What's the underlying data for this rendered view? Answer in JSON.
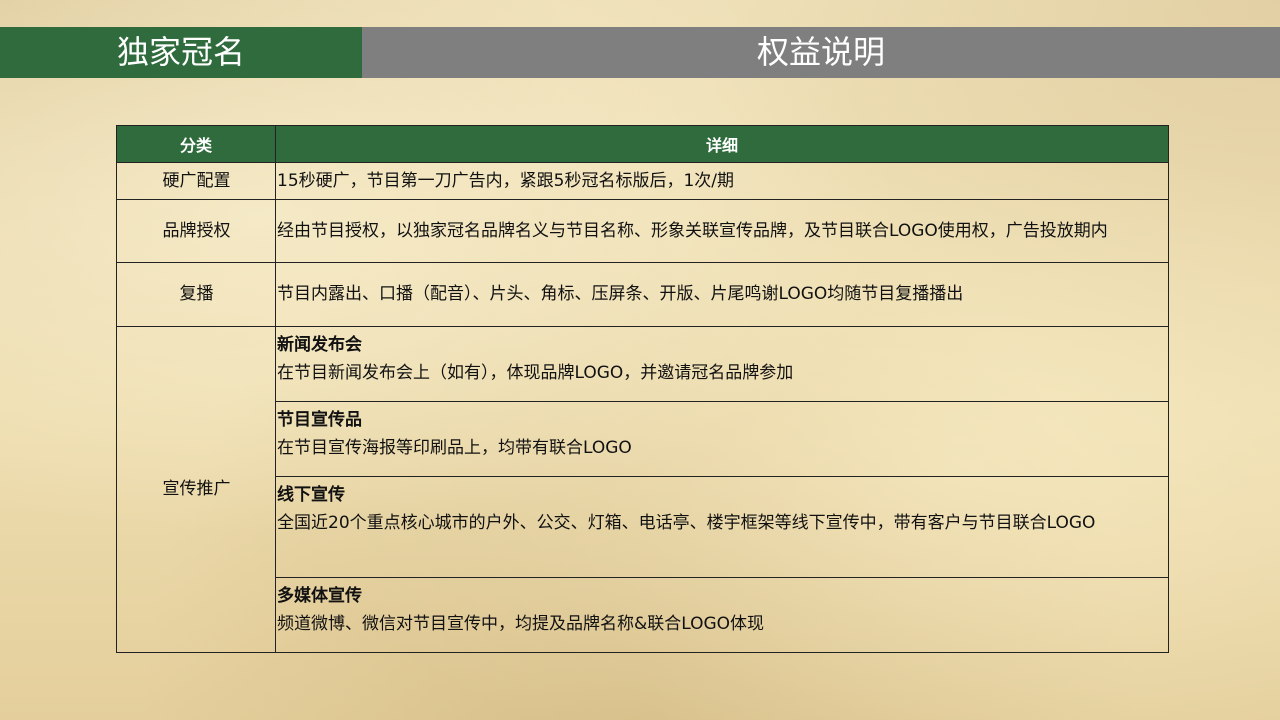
{
  "header": {
    "left_title": "独家冠名",
    "right_title": "权益说明"
  },
  "table": {
    "columns": [
      "分类",
      "详细"
    ],
    "rows": [
      {
        "category": "硬广配置",
        "detail": "15秒硬广，节目第一刀广告内，紧跟5秒冠名标版后，1次/期"
      },
      {
        "category": "品牌授权",
        "detail": "经由节目授权，以独家冠名品牌名义与节目名称、形象关联宣传品牌，及节目联合LOGO使用权，广告投放期内"
      },
      {
        "category": "复播",
        "detail": "节目内露出、口播（配音）、片头、角标、压屏条、开版、片尾鸣谢LOGO均随节目复播播出"
      }
    ],
    "promo": {
      "category": "宣传推广",
      "items": [
        {
          "title": "新闻发布会",
          "body": "在节目新闻发布会上（如有），体现品牌LOGO，并邀请冠名品牌参加"
        },
        {
          "title": "节目宣传品",
          "body": "在节目宣传海报等印刷品上，均带有联合LOGO"
        },
        {
          "title": "线下宣传",
          "body": "全国近20个重点核心城市的户外、公交、灯箱、电话亭、楼宇框架等线下宣传中，带有客户与节目联合LOGO"
        },
        {
          "title": "多媒体宣传",
          "body": "频道微博、微信对节目宣传中，均提及品牌名称&联合LOGO体现"
        }
      ]
    }
  },
  "colors": {
    "header_green": "#2f6b3c",
    "header_gray": "#7f7f7f",
    "background": "#eedfb6"
  }
}
